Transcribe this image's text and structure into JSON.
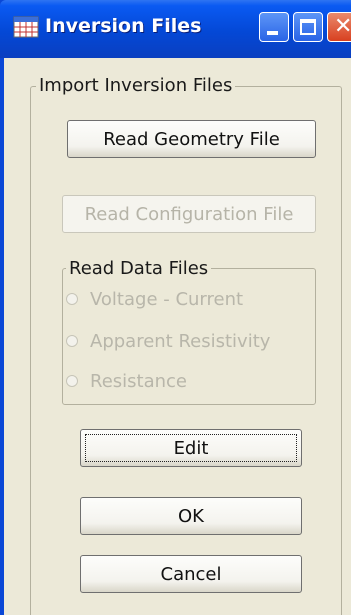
{
  "window": {
    "title": "Inversion Files",
    "icon": "grid-table-icon",
    "controls": [
      "minimize-icon",
      "maximize-icon",
      "close-icon"
    ]
  },
  "import_group": {
    "title": "Import Inversion Files",
    "read_geometry_label": "Read Geometry File",
    "read_configuration_label": "Read Configuration File",
    "read_configuration_enabled": false
  },
  "data_files_group": {
    "title": "Read Data Files",
    "options": [
      {
        "label": "Voltage - Current",
        "enabled": false,
        "selected": false
      },
      {
        "label": "Apparent Resistivity",
        "enabled": false,
        "selected": false
      },
      {
        "label": "Resistance",
        "enabled": false,
        "selected": false
      }
    ]
  },
  "buttons": {
    "edit_label": "Edit",
    "ok_label": "OK",
    "cancel_label": "Cancel"
  },
  "colors": {
    "titlebar": "#0448d6",
    "dialog_bg": "#ece9d8",
    "disabled_text": "#b8b6aa",
    "close_button": "#d84020"
  }
}
